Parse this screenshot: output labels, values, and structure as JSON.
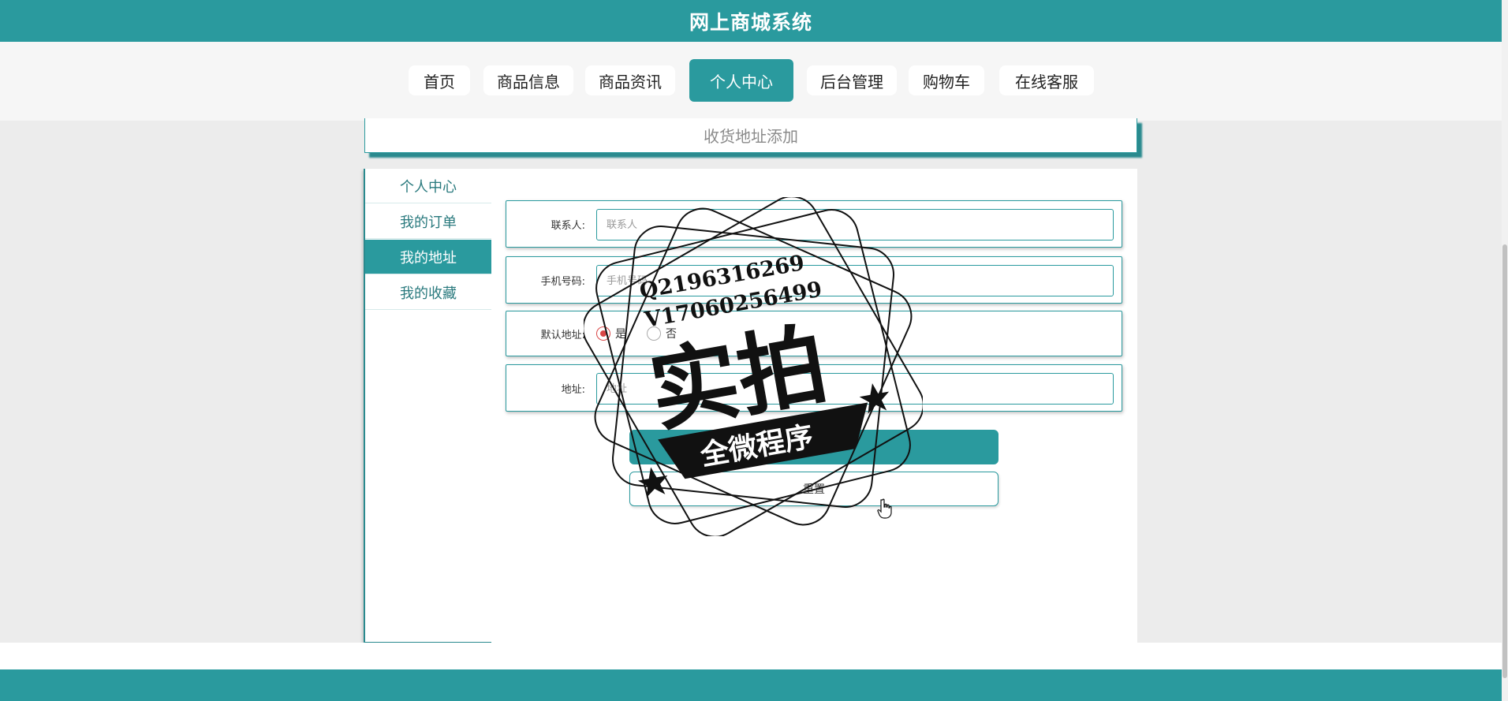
{
  "app": {
    "title": "网上商城系统"
  },
  "nav": {
    "items": [
      {
        "label": "首页"
      },
      {
        "label": "商品信息"
      },
      {
        "label": "商品资讯"
      },
      {
        "label": "个人中心",
        "active": true
      },
      {
        "label": "后台管理"
      },
      {
        "label": "购物车"
      },
      {
        "label": "在线客服"
      }
    ]
  },
  "page": {
    "title": "收货地址添加"
  },
  "sidebar": {
    "items": [
      {
        "label": "个人中心"
      },
      {
        "label": "我的订单"
      },
      {
        "label": "我的地址",
        "active": true
      },
      {
        "label": "我的收藏"
      }
    ]
  },
  "form": {
    "contact": {
      "label": "联系人:",
      "placeholder": "联系人",
      "value": ""
    },
    "phone": {
      "label": "手机号码:",
      "placeholder": "手机号码",
      "value": ""
    },
    "default_address": {
      "label": "默认地址:",
      "options": [
        {
          "label": "是",
          "checked": true
        },
        {
          "label": "否",
          "checked": false
        }
      ]
    },
    "address": {
      "label": "地址:",
      "placeholder": "地址",
      "value": ""
    },
    "submit_label": "",
    "reset_label": "重置"
  },
  "watermark": {
    "line1": "Q2196316269",
    "line2": "V17060256499",
    "main": "实拍",
    "ribbon": "全微程序"
  },
  "colors": {
    "primary": "#2a9a9e",
    "radio_checked": "#d94646"
  }
}
